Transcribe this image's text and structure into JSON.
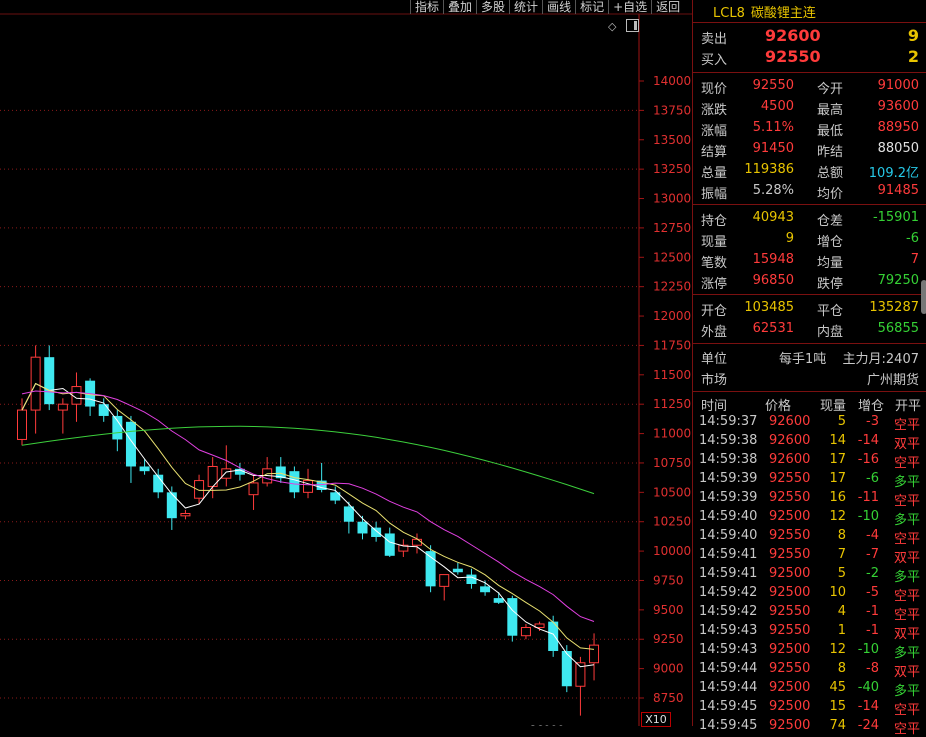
{
  "toolbar": {
    "items": [
      "指标",
      "叠加",
      "多股",
      "统计",
      "画线",
      "标记",
      "+自选",
      "返回"
    ]
  },
  "chart_data": {
    "type": "candlestick",
    "y_ticks": [
      "14000",
      "13750",
      "13500",
      "13250",
      "13000",
      "12750",
      "12500",
      "12250",
      "12000",
      "11750",
      "11500",
      "11250",
      "11000",
      "10750",
      "10500",
      "10250",
      "10000",
      "9750",
      "9500",
      "9250",
      "9000",
      "8750"
    ],
    "low_marker": "86000",
    "zoom_label": "X10",
    "candles": [
      {
        "o": 10950,
        "h": 11300,
        "l": 10900,
        "c": 11200
      },
      {
        "o": 11200,
        "h": 11750,
        "l": 11000,
        "c": 11650
      },
      {
        "o": 11650,
        "h": 11750,
        "l": 11200,
        "c": 11250
      },
      {
        "o": 11200,
        "h": 11300,
        "l": 11000,
        "c": 11250
      },
      {
        "o": 11250,
        "h": 11520,
        "l": 11100,
        "c": 11400
      },
      {
        "o": 11450,
        "h": 11470,
        "l": 11150,
        "c": 11230
      },
      {
        "o": 11250,
        "h": 11300,
        "l": 11100,
        "c": 11150
      },
      {
        "o": 11150,
        "h": 11200,
        "l": 10850,
        "c": 10950
      },
      {
        "o": 11100,
        "h": 11150,
        "l": 10580,
        "c": 10720
      },
      {
        "o": 10720,
        "h": 10780,
        "l": 10650,
        "c": 10680
      },
      {
        "o": 10650,
        "h": 10700,
        "l": 10450,
        "c": 10500
      },
      {
        "o": 10500,
        "h": 10550,
        "l": 10180,
        "c": 10280
      },
      {
        "o": 10300,
        "h": 10350,
        "l": 10270,
        "c": 10320
      },
      {
        "o": 10450,
        "h": 10650,
        "l": 10400,
        "c": 10600
      },
      {
        "o": 10550,
        "h": 10800,
        "l": 10450,
        "c": 10720
      },
      {
        "o": 10620,
        "h": 10900,
        "l": 10550,
        "c": 10700
      },
      {
        "o": 10700,
        "h": 10750,
        "l": 10600,
        "c": 10650
      },
      {
        "o": 10480,
        "h": 10650,
        "l": 10350,
        "c": 10580
      },
      {
        "o": 10580,
        "h": 10800,
        "l": 10550,
        "c": 10700
      },
      {
        "o": 10720,
        "h": 10800,
        "l": 10580,
        "c": 10620
      },
      {
        "o": 10680,
        "h": 10720,
        "l": 10450,
        "c": 10500
      },
      {
        "o": 10500,
        "h": 10700,
        "l": 10450,
        "c": 10600
      },
      {
        "o": 10600,
        "h": 10750,
        "l": 10500,
        "c": 10520
      },
      {
        "o": 10500,
        "h": 10550,
        "l": 10400,
        "c": 10430
      },
      {
        "o": 10380,
        "h": 10420,
        "l": 10150,
        "c": 10250
      },
      {
        "o": 10250,
        "h": 10300,
        "l": 10100,
        "c": 10150
      },
      {
        "o": 10200,
        "h": 10250,
        "l": 10080,
        "c": 10120
      },
      {
        "o": 10150,
        "h": 10200,
        "l": 9950,
        "c": 9960
      },
      {
        "o": 10000,
        "h": 10100,
        "l": 9950,
        "c": 10050
      },
      {
        "o": 10050,
        "h": 10150,
        "l": 9980,
        "c": 10100
      },
      {
        "o": 10000,
        "h": 10050,
        "l": 9650,
        "c": 9700
      },
      {
        "o": 9700,
        "h": 9800,
        "l": 9580,
        "c": 9800
      },
      {
        "o": 9850,
        "h": 9900,
        "l": 9800,
        "c": 9820
      },
      {
        "o": 9800,
        "h": 9850,
        "l": 9680,
        "c": 9720
      },
      {
        "o": 9700,
        "h": 9750,
        "l": 9620,
        "c": 9650
      },
      {
        "o": 9600,
        "h": 9650,
        "l": 9550,
        "c": 9560
      },
      {
        "o": 9600,
        "h": 9620,
        "l": 9230,
        "c": 9280
      },
      {
        "o": 9280,
        "h": 9380,
        "l": 9250,
        "c": 9350
      },
      {
        "o": 9350,
        "h": 9400,
        "l": 9320,
        "c": 9380
      },
      {
        "o": 9400,
        "h": 9450,
        "l": 9100,
        "c": 9150
      },
      {
        "o": 9150,
        "h": 9200,
        "l": 8800,
        "c": 8850
      },
      {
        "o": 8850,
        "h": 9100,
        "l": 8600,
        "c": 9050
      },
      {
        "o": 9050,
        "h": 9300,
        "l": 8900,
        "c": 9200
      }
    ]
  },
  "side": {
    "code": "LCL8",
    "name": "碳酸锂主连",
    "sell_label": "卖出",
    "sell_price": "92600",
    "sell_qty": "9",
    "buy_label": "买入",
    "buy_price": "92550",
    "buy_qty": "2",
    "q1": [
      {
        "l1": "现价",
        "v1": "92550",
        "c1": "red",
        "l2": "今开",
        "v2": "91000",
        "c2": "red"
      },
      {
        "l1": "涨跌",
        "v1": "4500",
        "c1": "red",
        "l2": "最高",
        "v2": "93600",
        "c2": "red"
      },
      {
        "l1": "涨幅",
        "v1": "5.11%",
        "c1": "red",
        "l2": "最低",
        "v2": "88950",
        "c2": "red"
      },
      {
        "l1": "结算",
        "v1": "91450",
        "c1": "red",
        "l2": "昨结",
        "v2": "88050",
        "c2": "white"
      },
      {
        "l1": "总量",
        "v1": "119386",
        "c1": "yellow",
        "l2": "总额",
        "v2": "109.2亿",
        "c2": "cyan"
      },
      {
        "l1": "振幅",
        "v1": "5.28%",
        "c1": "gray",
        "l2": "均价",
        "v2": "91485",
        "c2": "red"
      }
    ],
    "q2": [
      {
        "l1": "持仓",
        "v1": "40943",
        "c1": "yellow",
        "l2": "仓差",
        "v2": "-15901",
        "c2": "green"
      },
      {
        "l1": "现量",
        "v1": "9",
        "c1": "yellow",
        "l2": "增仓",
        "v2": "-6",
        "c2": "green"
      },
      {
        "l1": "笔数",
        "v1": "15948",
        "c1": "red",
        "l2": "均量",
        "v2": "7",
        "c2": "red"
      },
      {
        "l1": "涨停",
        "v1": "96850",
        "c1": "red",
        "l2": "跌停",
        "v2": "79250",
        "c2": "green"
      }
    ],
    "q3": [
      {
        "l1": "开仓",
        "v1": "103485",
        "c1": "yellow",
        "l2": "平仓",
        "v2": "135287",
        "c2": "yellow"
      },
      {
        "l1": "外盘",
        "v1": "62531",
        "c1": "red",
        "l2": "内盘",
        "v2": "56855",
        "c2": "green"
      }
    ],
    "unit_label": "单位",
    "unit_value": "每手1吨",
    "main_month": "主力月:2407",
    "market_label": "市场",
    "market_value": "广州期货",
    "tick_header": {
      "time": "时间",
      "price": "价格",
      "qty": "现量",
      "oi": "增仓",
      "type": "开平"
    },
    "ticks": [
      {
        "t": "14:59:37",
        "p": "92600",
        "pc": "red",
        "q": "5",
        "oi": "-3",
        "oc": "red",
        "k": "空平",
        "kc": "red"
      },
      {
        "t": "14:59:38",
        "p": "92600",
        "pc": "red",
        "q": "14",
        "oi": "-14",
        "oc": "red",
        "k": "双平",
        "kc": "red"
      },
      {
        "t": "14:59:38",
        "p": "92600",
        "pc": "red",
        "q": "17",
        "oi": "-16",
        "oc": "red",
        "k": "空平",
        "kc": "red"
      },
      {
        "t": "14:59:39",
        "p": "92550",
        "pc": "red",
        "q": "17",
        "oi": "-6",
        "oc": "green",
        "k": "多平",
        "kc": "green"
      },
      {
        "t": "14:59:39",
        "p": "92550",
        "pc": "red",
        "q": "16",
        "oi": "-11",
        "oc": "red",
        "k": "空平",
        "kc": "red"
      },
      {
        "t": "14:59:40",
        "p": "92500",
        "pc": "red",
        "q": "12",
        "oi": "-10",
        "oc": "green",
        "k": "多平",
        "kc": "green"
      },
      {
        "t": "14:59:40",
        "p": "92550",
        "pc": "red",
        "q": "8",
        "oi": "-4",
        "oc": "red",
        "k": "空平",
        "kc": "red"
      },
      {
        "t": "14:59:41",
        "p": "92550",
        "pc": "red",
        "q": "7",
        "oi": "-7",
        "oc": "red",
        "k": "双平",
        "kc": "red"
      },
      {
        "t": "14:59:41",
        "p": "92500",
        "pc": "red",
        "q": "5",
        "oi": "-2",
        "oc": "green",
        "k": "多平",
        "kc": "green"
      },
      {
        "t": "14:59:42",
        "p": "92500",
        "pc": "red",
        "q": "10",
        "oi": "-5",
        "oc": "red",
        "k": "空平",
        "kc": "red"
      },
      {
        "t": "14:59:42",
        "p": "92550",
        "pc": "red",
        "q": "4",
        "oi": "-1",
        "oc": "red",
        "k": "空平",
        "kc": "red"
      },
      {
        "t": "14:59:43",
        "p": "92550",
        "pc": "red",
        "q": "1",
        "oi": "-1",
        "oc": "red",
        "k": "双平",
        "kc": "red"
      },
      {
        "t": "14:59:43",
        "p": "92500",
        "pc": "red",
        "q": "12",
        "oi": "-10",
        "oc": "green",
        "k": "多平",
        "kc": "green"
      },
      {
        "t": "14:59:44",
        "p": "92550",
        "pc": "red",
        "q": "8",
        "oi": "-8",
        "oc": "red",
        "k": "双平",
        "kc": "red"
      },
      {
        "t": "14:59:44",
        "p": "92500",
        "pc": "red",
        "q": "45",
        "oi": "-40",
        "oc": "green",
        "k": "多平",
        "kc": "green"
      },
      {
        "t": "14:59:45",
        "p": "92500",
        "pc": "red",
        "q": "15",
        "oi": "-14",
        "oc": "red",
        "k": "空平",
        "kc": "red"
      },
      {
        "t": "14:59:45",
        "p": "92500",
        "pc": "red",
        "q": "74",
        "oi": "-24",
        "oc": "red",
        "k": "空平",
        "kc": "red"
      }
    ]
  }
}
